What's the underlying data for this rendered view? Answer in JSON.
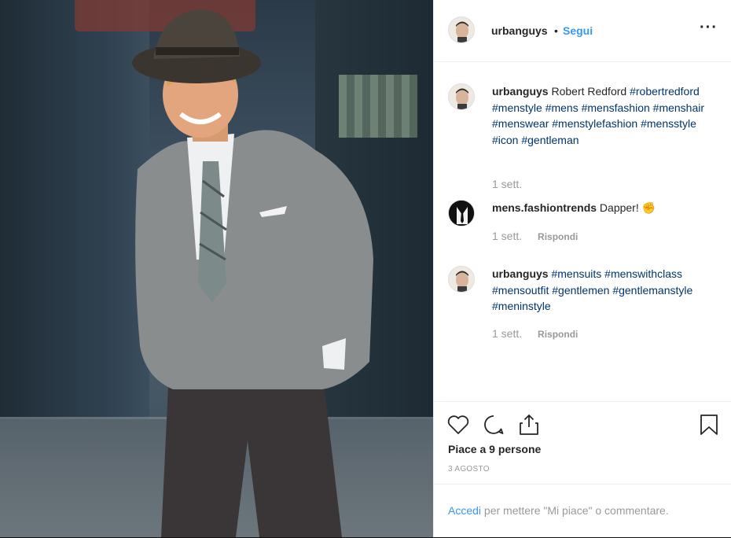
{
  "post": {
    "username": "urbanguys",
    "separator": "•",
    "follow_label": "Segui",
    "more_label": "···"
  },
  "comments": [
    {
      "username": "urbanguys",
      "text": "Robert Redford",
      "tags": "#robertredford #menstyle #mens #mensfashion #menshair #menswear #menstylefashion #mensstyle #icon #gentleman",
      "time": "1 sett.",
      "reply_label": ""
    },
    {
      "username": "mens.fashiontrends",
      "text": "Dapper! ✊",
      "tags": "",
      "time": "1 sett.",
      "reply_label": "Rispondi"
    },
    {
      "username": "urbanguys",
      "text": "",
      "tags": "#mensuits #menswithclass #mensoutfit #gentlemen #gentlemanstyle #meninstyle",
      "time": "1 sett.",
      "reply_label": "Rispondi"
    }
  ],
  "stats": {
    "likes_label": "Piace a 9 persone",
    "date_label": "3 AGOSTO"
  },
  "footer": {
    "login_label": "Accedi",
    "rest_label": " per mettere \"Mi piace\" o commentare."
  },
  "icons": [
    "heart-icon",
    "comment-icon",
    "share-icon",
    "bookmark-icon",
    "more-icon"
  ],
  "colors": {
    "link": "#3897f0",
    "hashtag": "#003569",
    "muted": "#999999",
    "text": "#262626"
  }
}
